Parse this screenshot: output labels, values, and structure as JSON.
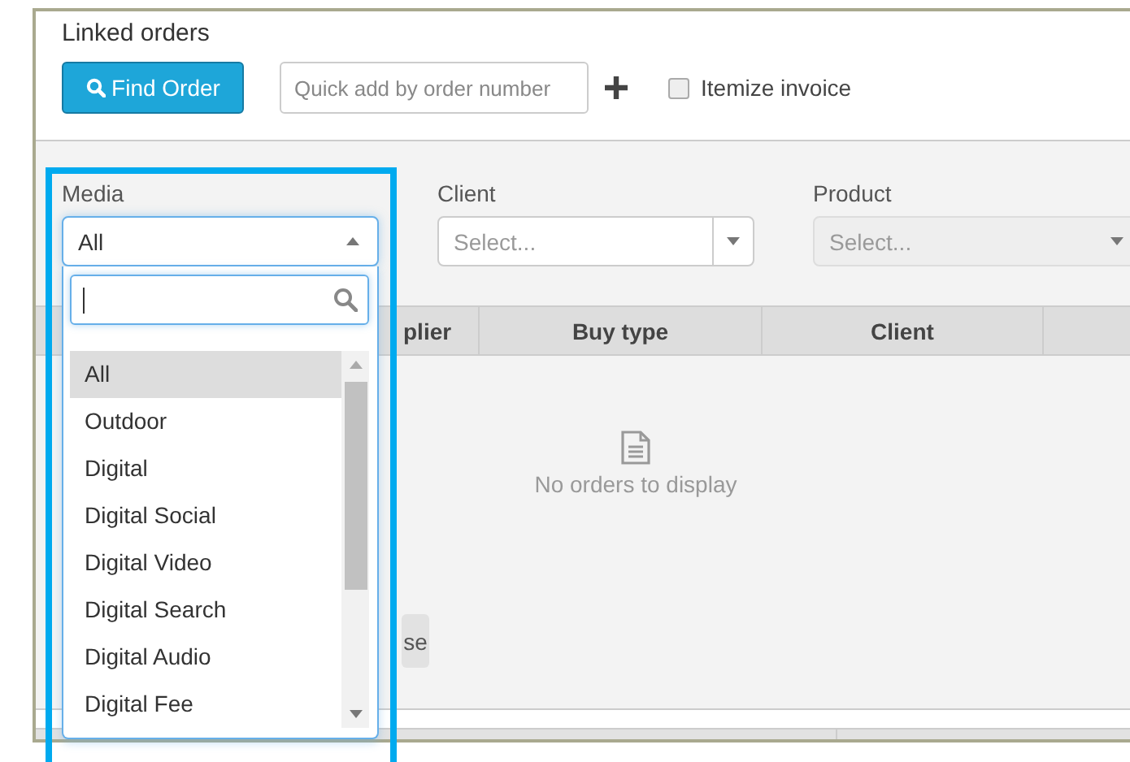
{
  "title": "Linked orders",
  "toolbar": {
    "find_button": "Find Order",
    "quick_add": {
      "placeholder": "Quick add by order number"
    },
    "itemize": {
      "label": "Itemize invoice",
      "checked": false
    }
  },
  "filters": [
    {
      "label": "Media",
      "value": "All",
      "open": true,
      "disabled": false
    },
    {
      "label": "Client",
      "placeholder": "Select...",
      "open": false,
      "disabled": false
    },
    {
      "label": "Product",
      "placeholder": "Select...",
      "open": false,
      "disabled": true
    }
  ],
  "media_dropdown": {
    "options": [
      {
        "label": "All",
        "selected": true
      },
      {
        "label": "Outdoor",
        "selected": false
      },
      {
        "label": "Digital",
        "selected": false
      },
      {
        "label": "Digital Social",
        "selected": false
      },
      {
        "label": "Digital Video",
        "selected": false
      },
      {
        "label": "Digital Search",
        "selected": false
      },
      {
        "label": "Digital Audio",
        "selected": false
      },
      {
        "label": "Digital Fee",
        "selected": false
      }
    ]
  },
  "table": {
    "columns": [
      "plier",
      "Buy type",
      "Client"
    ],
    "empty_message": "No orders to display",
    "partial_button": "se"
  }
}
